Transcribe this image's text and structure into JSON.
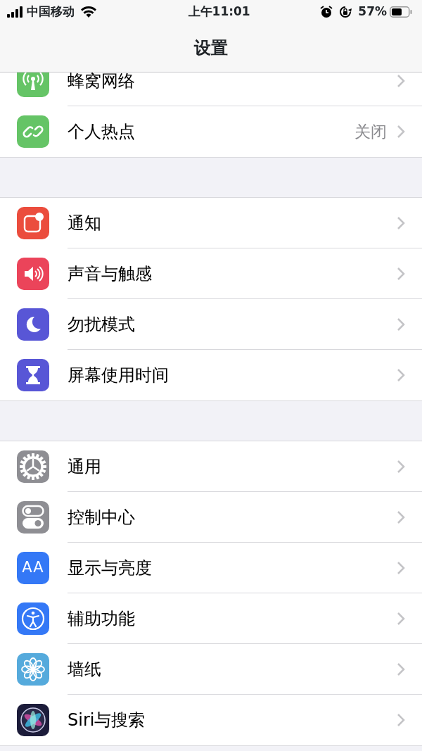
{
  "status_bar": {
    "carrier": "中国移动",
    "time": "上午11:01",
    "battery": "57%"
  },
  "nav_bar": {
    "title": "设置"
  },
  "groups": [
    {
      "items": [
        {
          "color": "#65c466",
          "label": "蜂窝网络"
        },
        {
          "color": "#65c466",
          "label": "个人热点",
          "value": "关闭"
        }
      ]
    },
    {
      "items": [
        {
          "color": "#eb4d3d",
          "label": "通知"
        },
        {
          "color": "#eb445a",
          "label": "声音与触感"
        },
        {
          "color": "#5856d6",
          "label": "勿扰模式"
        },
        {
          "color": "#5856d6",
          "label": "屏幕使用时间"
        }
      ]
    },
    {
      "items": [
        {
          "color": "#8e8e93",
          "label": "通用"
        },
        {
          "color": "#8e8e93",
          "label": "控制中心"
        },
        {
          "color": "#3478f6",
          "glyph": "AA",
          "label": "显示与亮度"
        },
        {
          "color": "#3478f6",
          "label": "辅助功能"
        },
        {
          "color": "#55aadc",
          "label": "墙纸"
        },
        {
          "color": "#1c1c3a",
          "label": "Siri与搜索"
        }
      ]
    }
  ]
}
